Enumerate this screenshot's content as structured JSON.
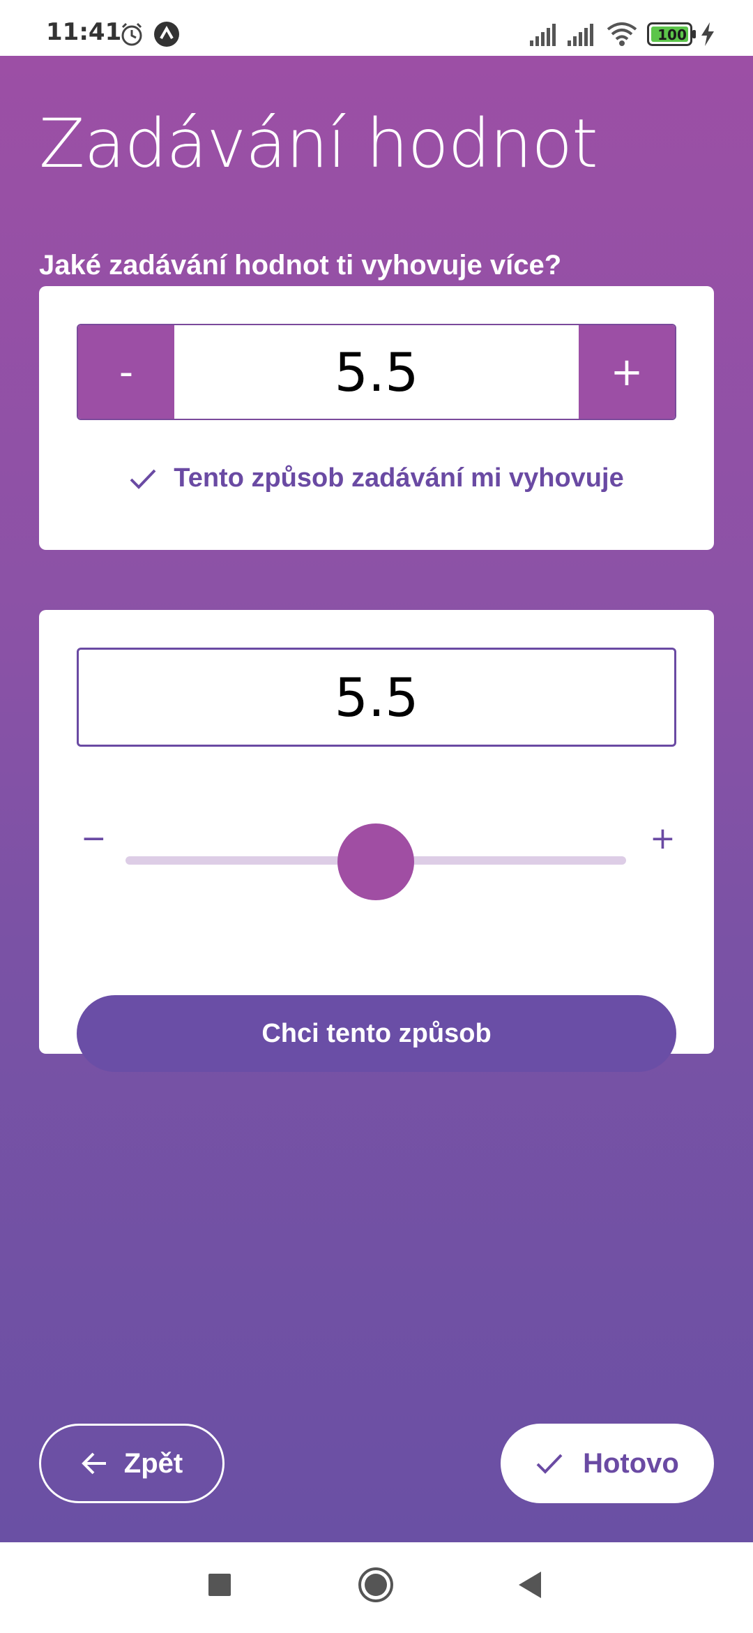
{
  "status_bar": {
    "time": "11:41",
    "battery": "100",
    "icons": [
      "alarm-icon",
      "app-notification-icon",
      "signal-icon",
      "signal-icon",
      "wifi-icon",
      "battery-icon",
      "charging-icon"
    ]
  },
  "page": {
    "title": "Zadávání hodnot",
    "question": "Jaké zadávání hodnot ti vyhovuje více?"
  },
  "option_stepper": {
    "minus_label": "-",
    "plus_label": "+",
    "value": "5.5",
    "selected_text": "Tento způsob zadávání mi vyhovuje"
  },
  "option_slider": {
    "value": "5.5",
    "minus_label": "−",
    "plus_label": "+",
    "slider_fraction": 0.5,
    "choose_label": "Chci tento způsob"
  },
  "footer": {
    "back_label": "Zpět",
    "done_label": "Hotovo"
  },
  "colors": {
    "gradient_top": "#9c4fa5",
    "gradient_bottom": "#6a50a4",
    "accent": "#6a4aa3",
    "stepper_button": "#9c4fa5",
    "slider_thumb": "#a04ea3",
    "slider_track": "#ddcde6",
    "choose_button": "#6a4ea6"
  },
  "navigation_bar": {
    "icons": [
      "recents-square-icon",
      "home-circle-icon",
      "back-triangle-icon"
    ]
  }
}
